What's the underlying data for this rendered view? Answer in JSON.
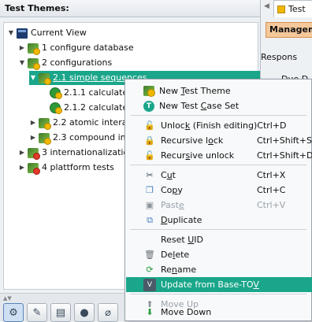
{
  "left_panel": {
    "title": "Test Themes:",
    "tree": [
      {
        "label": "Current View",
        "expanded": true,
        "icon": "current-view-icon"
      },
      {
        "label": "1 configure database",
        "expanded": false,
        "icon": "test-theme-icon"
      },
      {
        "label": "2 configurations",
        "expanded": true,
        "icon": "test-theme-icon"
      },
      {
        "label": "2.1 simple sequences",
        "expanded": true,
        "icon": "test-theme-icon",
        "selected": true
      },
      {
        "label": "2.1.1 calculate p",
        "icon": "test-case-icon"
      },
      {
        "label": "2.1.2 calculate p",
        "icon": "test-case-icon"
      },
      {
        "label": "2.2 atomic interacti",
        "expanded": false,
        "icon": "test-theme-icon"
      },
      {
        "label": "2.3 compound inter",
        "expanded": false,
        "icon": "test-theme-icon"
      },
      {
        "label": "3 internationalization",
        "expanded": false,
        "icon": "test-theme-icon"
      },
      {
        "label": "4 plattform tests",
        "expanded": false,
        "icon": "test-theme-icon"
      }
    ],
    "toolbar_icons": [
      "settings-gear-icon",
      "wrench-icon",
      "document-icon",
      "record-icon",
      "attachment-icon"
    ]
  },
  "right_panel": {
    "tab_label": "Test",
    "section_label": "Managem",
    "field1": "Respons",
    "field2": "Due D"
  },
  "context_menu": {
    "items": [
      {
        "pre": "New ",
        "u": "T",
        "post": "est Theme",
        "key": "",
        "icon": "new-test-theme-icon"
      },
      {
        "pre": "New Test ",
        "u": "C",
        "post": "ase Set",
        "key": "",
        "icon": "new-test-case-set-icon"
      },
      {
        "pre": "Unloc",
        "u": "k",
        "post": " (Finish editing)",
        "key": "Ctrl+D",
        "icon": "unlock-icon"
      },
      {
        "pre": "Recursive l",
        "u": "o",
        "post": "ck",
        "key": "Ctrl+Shift+S",
        "icon": "lock-icon"
      },
      {
        "pre": "Recur",
        "u": "s",
        "post": "ive unlock",
        "key": "Ctrl+Shift+D",
        "icon": "unlock-icon"
      },
      {
        "pre": "C",
        "u": "u",
        "post": "t",
        "key": "Ctrl+X",
        "icon": "scissors-icon"
      },
      {
        "pre": "Co",
        "u": "p",
        "post": "y",
        "key": "Ctrl+C",
        "icon": "copy-icon"
      },
      {
        "pre": "Past",
        "u": "e",
        "post": "",
        "key": "Ctrl+V",
        "icon": "paste-icon",
        "disabled": true
      },
      {
        "pre": "",
        "u": "D",
        "post": "uplicate",
        "key": "",
        "icon": "duplicate-icon"
      },
      {
        "pre": "Reset ",
        "u": "U",
        "post": "ID",
        "key": "",
        "icon": ""
      },
      {
        "pre": "De",
        "u": "l",
        "post": "ete",
        "key": "",
        "icon": "trash-icon"
      },
      {
        "pre": "Re",
        "u": "n",
        "post": "ame",
        "key": "",
        "icon": "rename-icon"
      },
      {
        "pre": "Update from Base-TO",
        "u": "V",
        "post": "",
        "key": "",
        "icon": "update-base-tov-icon",
        "highlighted": true
      },
      {
        "pre": "Move Up",
        "u": "",
        "post": "",
        "key": "",
        "icon": "arrow-up-icon",
        "disabled": true
      },
      {
        "pre": "Move Down",
        "u": "",
        "post": "",
        "key": "",
        "icon": "arrow-down-icon"
      }
    ]
  },
  "colors": {
    "selection": "#1aa68a",
    "accent_orange": "#f4c89a"
  }
}
